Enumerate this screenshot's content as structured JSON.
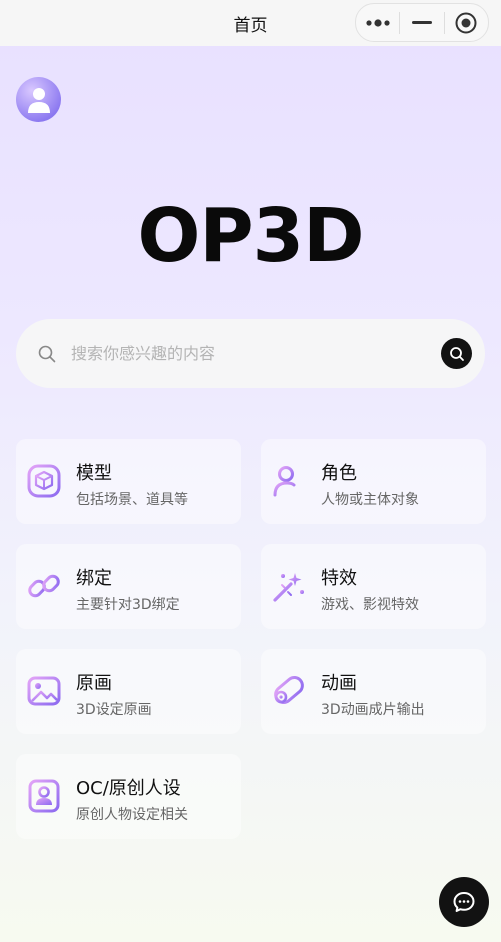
{
  "nav": {
    "title": "首页",
    "capsule": {
      "more_icon": "more-dots-icon",
      "minimize_icon": "minimize-icon",
      "close_icon": "target-icon"
    }
  },
  "profile": {
    "avatar_icon": "user-icon"
  },
  "brand": {
    "logo_text": "OP3D"
  },
  "search": {
    "placeholder": "搜索你感兴趣的内容",
    "value": ""
  },
  "categories": [
    {
      "title": "模型",
      "subtitle": "包括场景、道具等",
      "icon": "cube-box-icon"
    },
    {
      "title": "角色",
      "subtitle": "人物或主体对象",
      "icon": "user-add-icon"
    },
    {
      "title": "绑定",
      "subtitle": "主要针对3D绑定",
      "icon": "link-chain-icon"
    },
    {
      "title": "特效",
      "subtitle": "游戏、影视特效",
      "icon": "magic-wand-icon"
    },
    {
      "title": "原画",
      "subtitle": "3D设定原画",
      "icon": "picture-icon"
    },
    {
      "title": "动画",
      "subtitle": "3D动画成片输出",
      "icon": "film-roll-icon"
    },
    {
      "title": "OC/原创人设",
      "subtitle": "原创人物设定相关",
      "icon": "portrait-icon"
    }
  ],
  "chat": {
    "icon": "chat-bubble-icon"
  },
  "colors": {
    "accent": "#8b78f0",
    "icon_gradient_start": "#c98cf5",
    "icon_gradient_end": "#8c6af0",
    "dark": "#121212"
  }
}
